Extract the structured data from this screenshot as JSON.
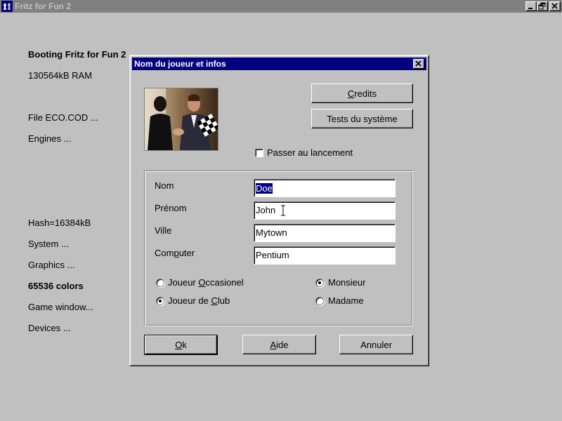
{
  "window": {
    "title": "Fritz for Fun 2"
  },
  "boot_log": [
    {
      "text": "Booting Fritz for Fun 2",
      "bold": true
    },
    {
      "text": "130564kB RAM",
      "bold": false
    },
    {
      "text": "File ECO.COD ...",
      "bold": false
    },
    {
      "text": "Engines ...",
      "bold": false
    },
    {
      "text": "Hash=16384kB",
      "bold": false
    },
    {
      "text": "System ...",
      "bold": false
    },
    {
      "text": "Graphics ...",
      "bold": false
    },
    {
      "text": "65536 colors",
      "bold": true
    },
    {
      "text": "Game window...",
      "bold": false
    },
    {
      "text": "Devices ...",
      "bold": false
    }
  ],
  "dialog": {
    "title": "Nom du joueur et infos",
    "credits_button": {
      "pre": "",
      "accel": "C",
      "post": "redits"
    },
    "system_tests_button": "Tests du système",
    "skip_checkbox": {
      "label": "Passer au lancement",
      "checked": false
    },
    "fields": {
      "nom": {
        "label": "Nom",
        "value": "Doe"
      },
      "prenom": {
        "label": "Prénom",
        "value": "John"
      },
      "ville": {
        "label": "Ville",
        "value": "Mytown"
      },
      "computer": {
        "label_pre": "Com",
        "label_accel": "p",
        "label_post": "uter",
        "value": "Pentium"
      }
    },
    "player_type": {
      "occasional": {
        "pre": "Joueur ",
        "accel": "O",
        "post": "ccasionel",
        "selected": false
      },
      "club": {
        "pre": "Joueur de ",
        "accel": "C",
        "post": "lub",
        "selected": true
      }
    },
    "title_choice": {
      "monsieur": {
        "label": "Monsieur",
        "selected": true
      },
      "madame": {
        "label": "Madame",
        "selected": false
      }
    },
    "ok_button": {
      "accel": "O",
      "post": "k"
    },
    "help_button": {
      "accel": "A",
      "post": "ide"
    },
    "cancel_button": "Annuler"
  },
  "colors": {
    "desktop": "#c0c0c0",
    "active_title": "#000080",
    "inactive_title": "#808080",
    "selection": "#000080"
  }
}
